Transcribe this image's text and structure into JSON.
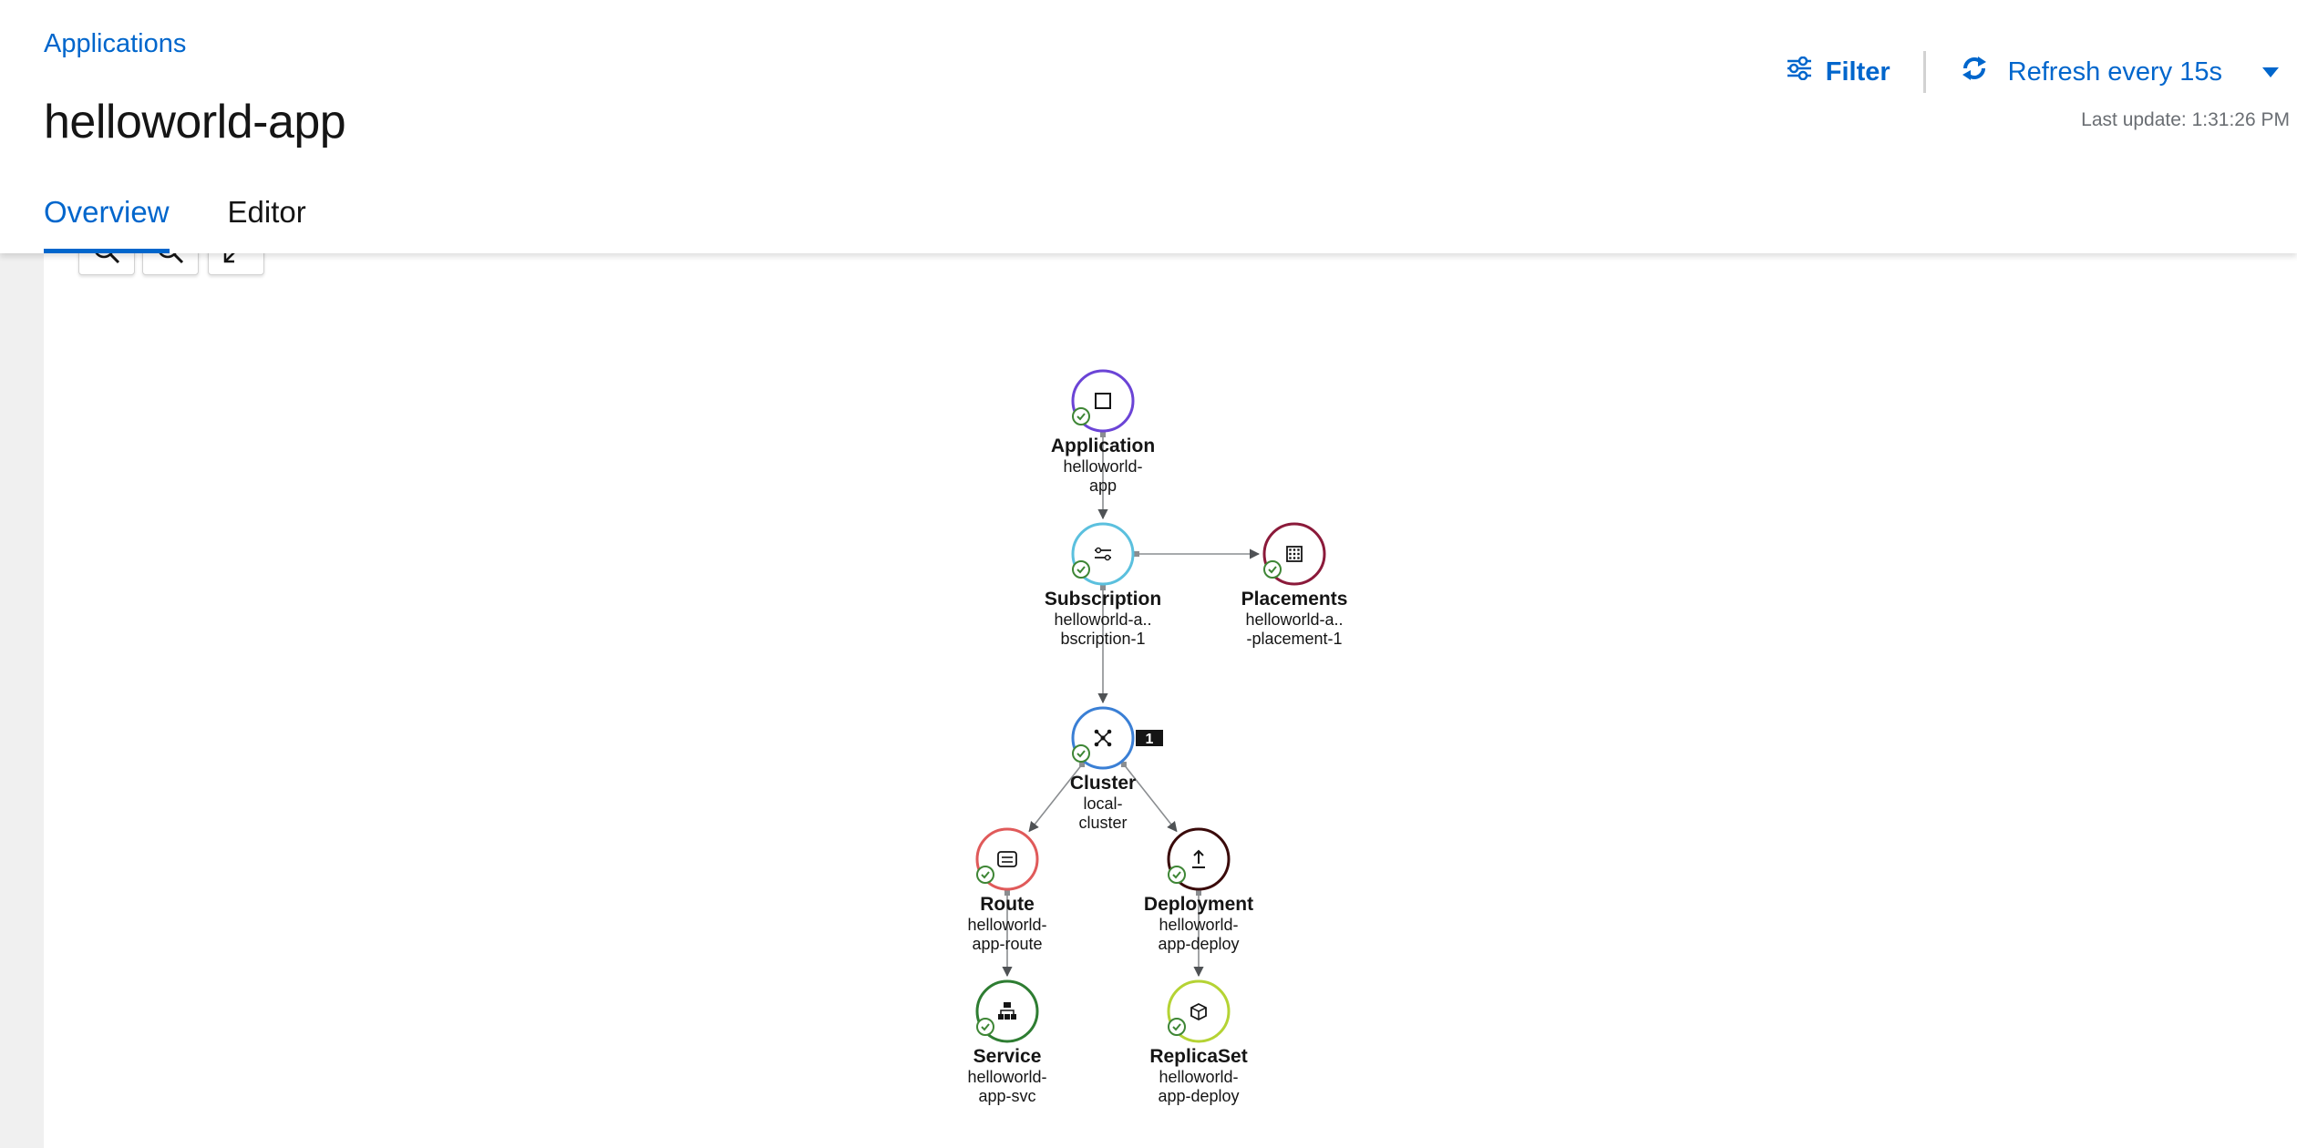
{
  "header": {
    "breadcrumb": "Applications",
    "title": "helloworld-app",
    "tabs": [
      {
        "label": "Overview",
        "active": true
      },
      {
        "label": "Editor",
        "active": false
      }
    ],
    "filter_label": "Filter",
    "refresh_label": "Refresh every 15s",
    "last_update": "Last update: 1:31:26 PM"
  },
  "canvas": {
    "zoom_controls": [
      "zoom-in-icon",
      "search-icon",
      "fit-to-screen-icon"
    ]
  },
  "colors": {
    "accent": "#0066cc",
    "status_ok": "#3e8635"
  },
  "nodes": [
    {
      "id": "application",
      "title": "Application",
      "lines": [
        "helloworld-",
        "app"
      ],
      "ring_color": "#6b44d6",
      "icon": "application-icon",
      "status": "ok"
    },
    {
      "id": "subscription",
      "title": "Subscription",
      "lines": [
        "helloworld-a..",
        "bscription-1"
      ],
      "ring_color": "#5bc0de",
      "icon": "subscription-icon",
      "status": "ok"
    },
    {
      "id": "placements",
      "title": "Placements",
      "lines": [
        "helloworld-a..",
        "-placement-1"
      ],
      "ring_color": "#8b1a3a",
      "icon": "placements-icon",
      "status": "ok"
    },
    {
      "id": "cluster",
      "title": "Cluster",
      "lines": [
        "local-",
        "cluster"
      ],
      "ring_color": "#3a7fd5",
      "icon": "cluster-icon",
      "status": "ok",
      "badge": "1"
    },
    {
      "id": "route",
      "title": "Route",
      "lines": [
        "helloworld-",
        "app-route"
      ],
      "ring_color": "#e05a5a",
      "icon": "route-icon",
      "status": "ok"
    },
    {
      "id": "deployment",
      "title": "Deployment",
      "lines": [
        "helloworld-",
        "app-deploy"
      ],
      "ring_color": "#3a0a0a",
      "icon": "deployment-icon",
      "status": "ok"
    },
    {
      "id": "service",
      "title": "Service",
      "lines": [
        "helloworld-",
        "app-svc"
      ],
      "ring_color": "#2e7d32",
      "icon": "service-icon",
      "status": "ok"
    },
    {
      "id": "replicaset",
      "title": "ReplicaSet",
      "lines": [
        "helloworld-",
        "app-deploy"
      ],
      "ring_color": "#b5d334",
      "icon": "replicaset-icon",
      "status": "ok"
    }
  ],
  "edges": [
    {
      "from": "application",
      "to": "subscription"
    },
    {
      "from": "subscription",
      "to": "placements"
    },
    {
      "from": "subscription",
      "to": "cluster"
    },
    {
      "from": "cluster",
      "to": "route"
    },
    {
      "from": "cluster",
      "to": "deployment"
    },
    {
      "from": "route",
      "to": "service"
    },
    {
      "from": "deployment",
      "to": "replicaset"
    }
  ]
}
